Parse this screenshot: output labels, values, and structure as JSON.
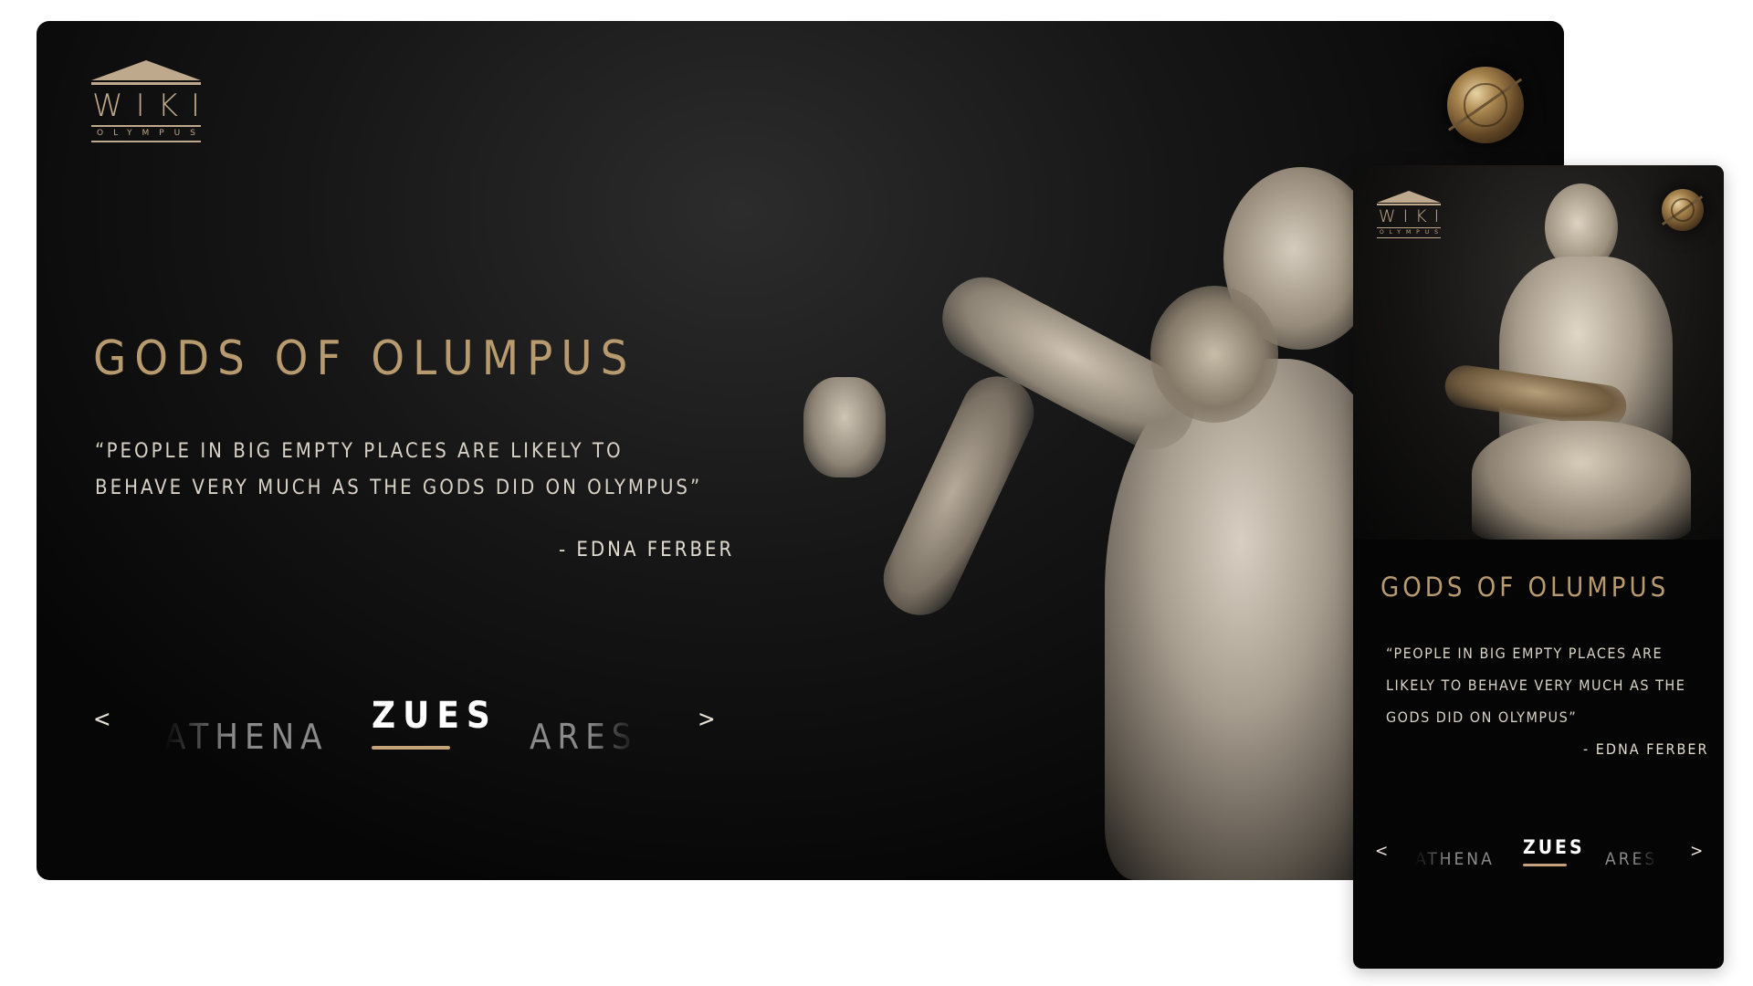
{
  "brand": {
    "word": "WIKI",
    "sub": "OLYMPUS"
  },
  "page": {
    "title": "GODS OF OLUMPUS",
    "quote": "“PEOPLE IN BIG EMPTY PLACES ARE LIKELY TO BEHAVE VERY MUCH AS THE GODS DID ON OLYMPUS”",
    "author": "- EDNA FERBER"
  },
  "carousel": {
    "prev": "<",
    "next": ">",
    "items": [
      {
        "label": "ATHENA"
      },
      {
        "label": "ZUES"
      },
      {
        "label": "ARES"
      }
    ],
    "active_index": 1
  },
  "icons": [
    "logo-temple-icon",
    "shield-icon",
    "statue-image"
  ],
  "colors": {
    "accent_gold": "#c4a27a",
    "title_gold": "#b89a6f",
    "background": "#0a0a0a"
  }
}
